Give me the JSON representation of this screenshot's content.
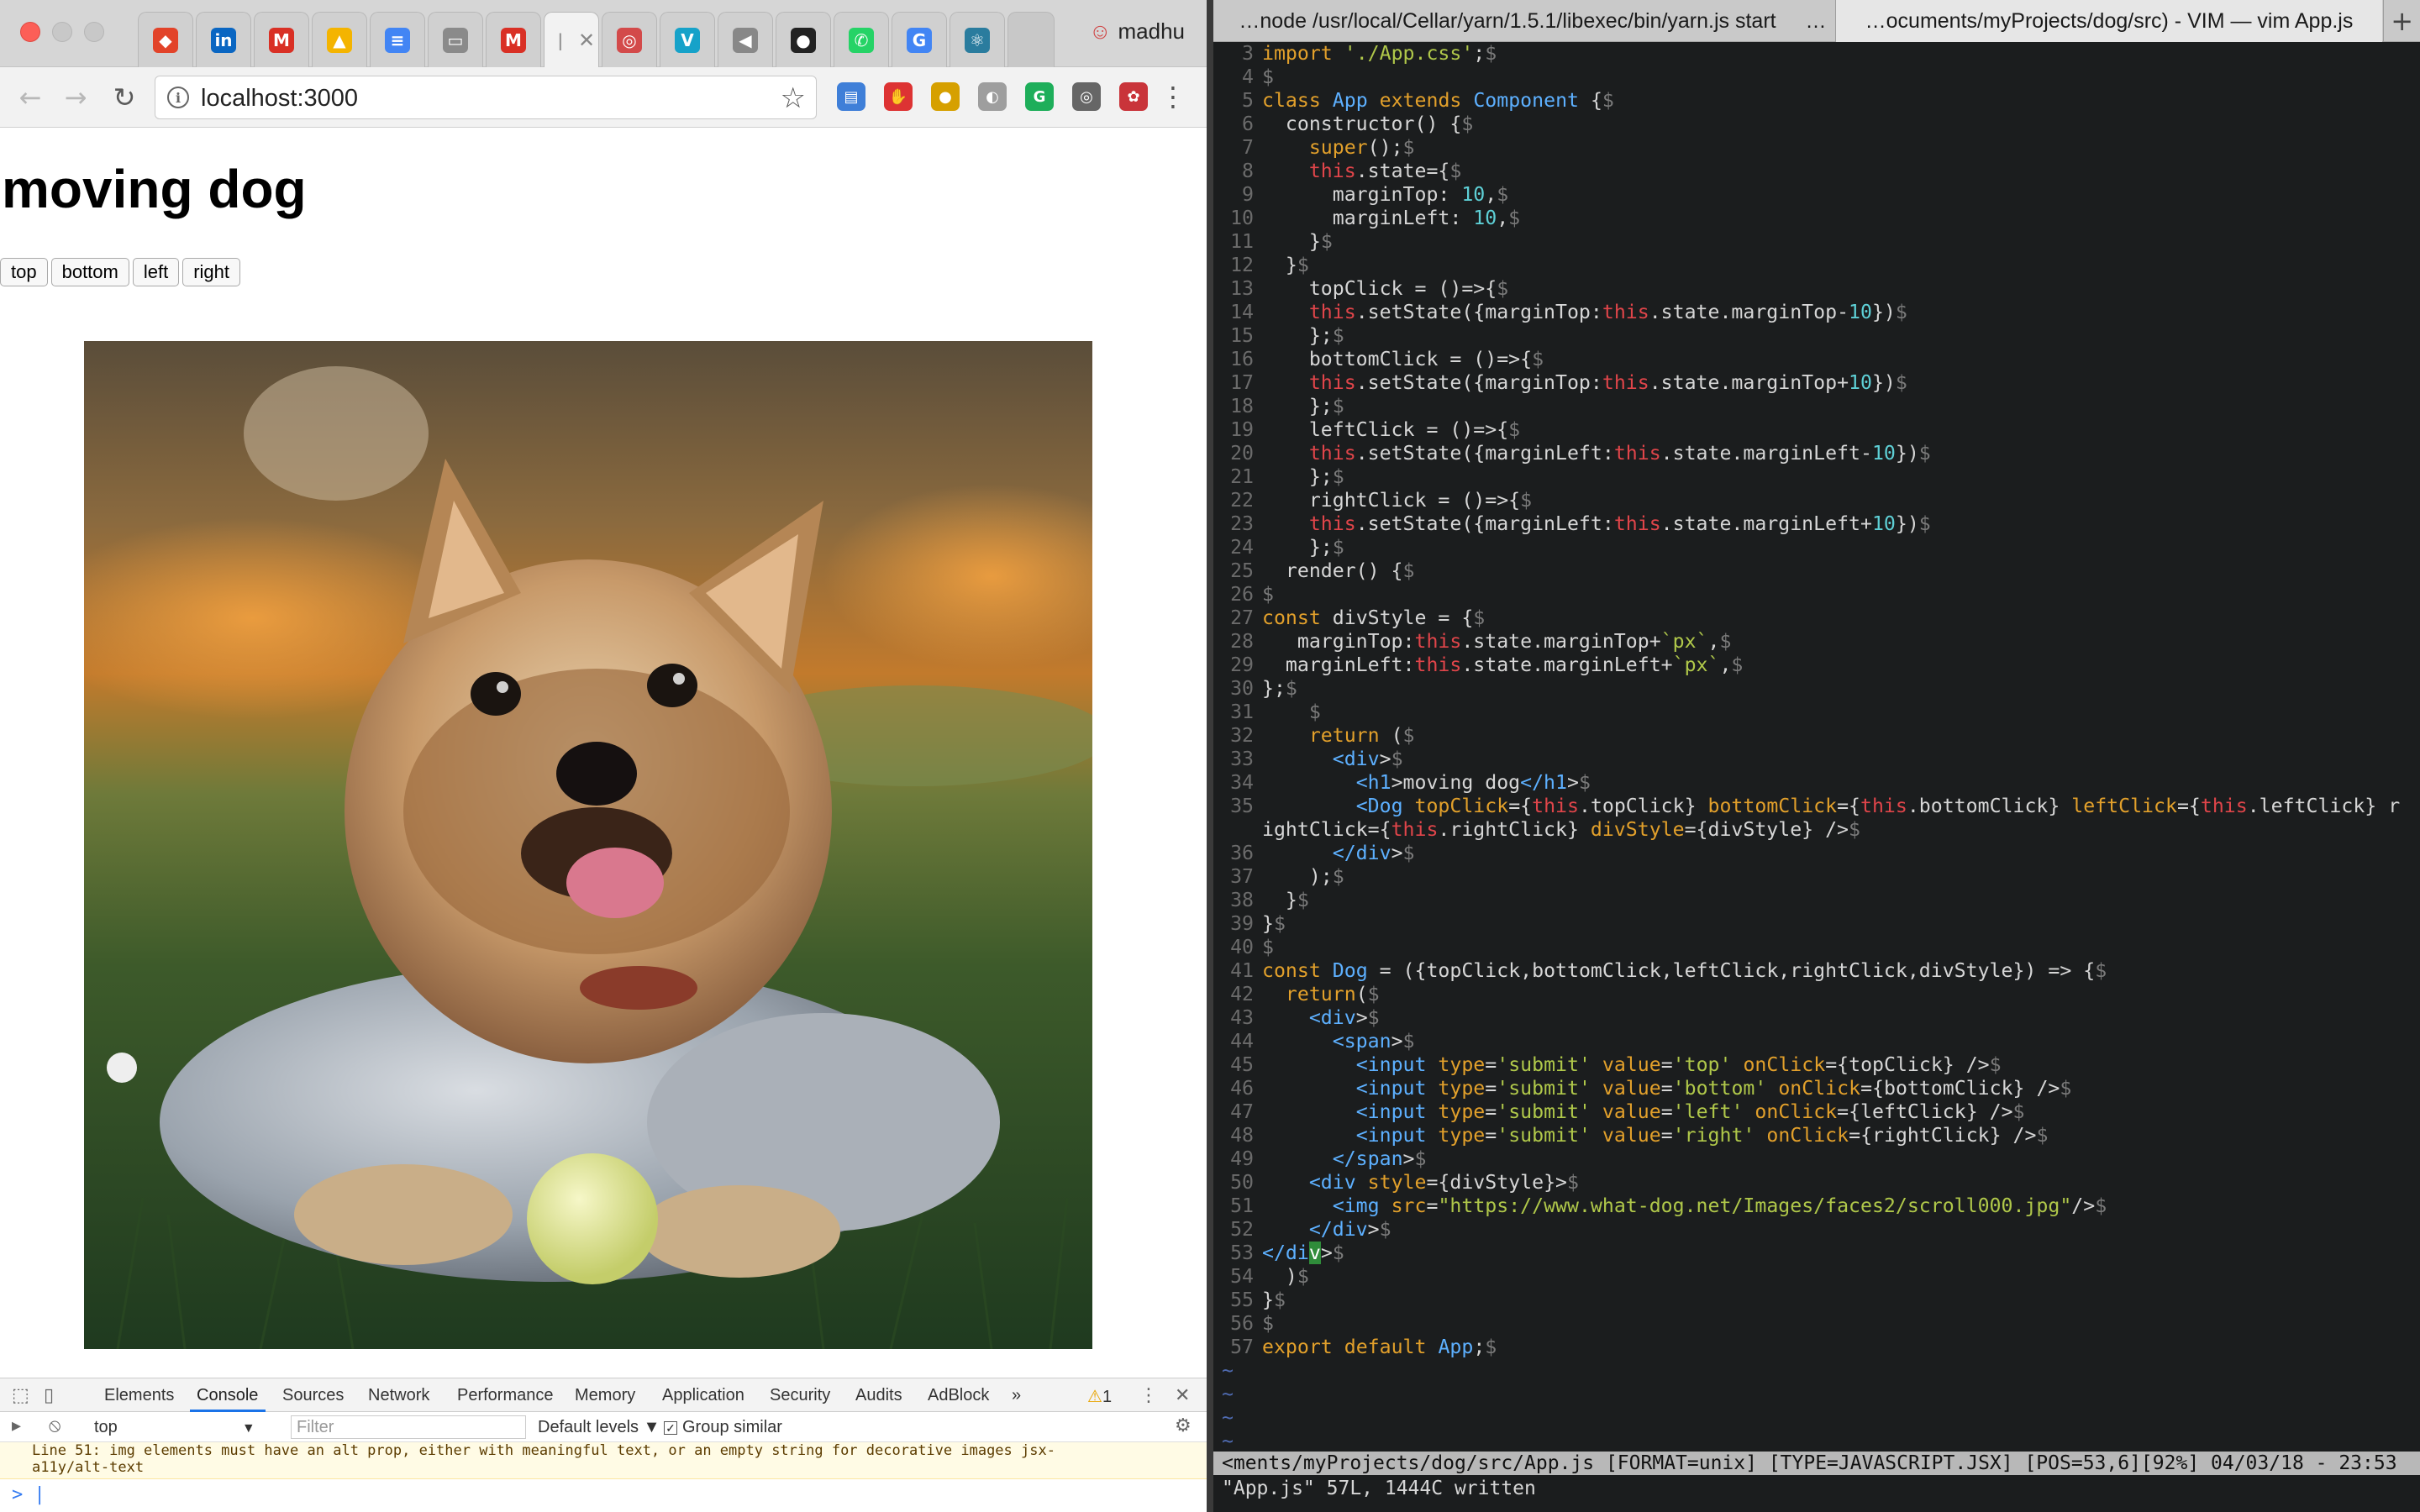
{
  "browser": {
    "profile_name": "madhu",
    "tabs": [
      {
        "icon": "gitlab-icon",
        "color": "#e24329"
      },
      {
        "icon": "linkedin-icon",
        "color": "#0a66c2"
      },
      {
        "icon": "gmail-icon",
        "color": "#d93025"
      },
      {
        "icon": "drive-icon",
        "color": "#f4b400"
      },
      {
        "icon": "docs-icon",
        "color": "#4285f4"
      },
      {
        "icon": "file-icon",
        "color": "#8a8a8a"
      },
      {
        "icon": "gmail-icon",
        "color": "#d93025"
      },
      {
        "icon": "active-tab-icon",
        "color": "#9a9a9a"
      },
      {
        "icon": "app-icon",
        "color": "#d34a4a"
      },
      {
        "icon": "vectr-icon",
        "color": "#16a2c9"
      },
      {
        "icon": "media-icon",
        "color": "#888888"
      },
      {
        "icon": "github-icon",
        "color": "#222222"
      },
      {
        "icon": "whatsapp-icon",
        "color": "#25d366"
      },
      {
        "icon": "google-icon",
        "color": "#4285f4"
      },
      {
        "icon": "react-icon",
        "color": "#2a7c9e"
      }
    ],
    "active_tab_close": "✕",
    "url": "localhost:3000",
    "extension_colors": [
      "#3f7fd8",
      "#d33",
      "#d6a000",
      "#9e9e9e",
      "#1eae5a",
      "#666",
      "#c9343a"
    ]
  },
  "page": {
    "title": "moving dog",
    "buttons": [
      "top",
      "bottom",
      "left",
      "right"
    ],
    "image_alt_subject": "yorkshire terrier puppy lying on grass with a tennis ball"
  },
  "devtools": {
    "tabs": [
      "Elements",
      "Console",
      "Sources",
      "Network",
      "Performance",
      "Memory",
      "Application",
      "Security",
      "Audits",
      "AdBlock"
    ],
    "active_tab": "Console",
    "more": "»",
    "warning_count": "1",
    "context": "top",
    "filter_placeholder": "Filter",
    "levels": "Default levels ▼",
    "group_similar": "Group similar",
    "warning_line1": "Line 51:  img elements must have an alt prop, either with meaningful text, or an empty string for decorative images  jsx-",
    "warning_line2": "a11y/alt-text",
    "prompt": "> |"
  },
  "terminal": {
    "tabs": [
      "…node /usr/local/Cellar/yarn/1.5.1/libexec/bin/yarn.js start",
      "…ocuments/myProjects/dog/src) - VIM — vim App.js"
    ],
    "tab_overflow": "…",
    "add_tab": "+",
    "statusline": "<ments/myProjects/dog/src/App.js [FORMAT=unix] [TYPE=JAVASCRIPT.JSX] [POS=53,6][92%] 04/03/18 - 23:53",
    "message": "\"App.js\" 57L, 1444C written",
    "tilde": "~",
    "code": [
      {
        "n": "3",
        "t": "import './App.css';$"
      },
      {
        "n": "4",
        "t": "$"
      },
      {
        "n": "5",
        "t": "class App extends Component {$"
      },
      {
        "n": "6",
        "t": "  constructor() {$"
      },
      {
        "n": "7",
        "t": "    super();$"
      },
      {
        "n": "8",
        "t": "    this.state={$"
      },
      {
        "n": "9",
        "t": "      marginTop: 10,$"
      },
      {
        "n": "10",
        "t": "      marginLeft: 10,$"
      },
      {
        "n": "11",
        "t": "    }$"
      },
      {
        "n": "12",
        "t": "  }$"
      },
      {
        "n": "13",
        "t": "    topClick = ()=>{$"
      },
      {
        "n": "14",
        "t": "    this.setState({marginTop:this.state.marginTop-10})$"
      },
      {
        "n": "15",
        "t": "    };$"
      },
      {
        "n": "16",
        "t": "    bottomClick = ()=>{$"
      },
      {
        "n": "17",
        "t": "    this.setState({marginTop:this.state.marginTop+10})$"
      },
      {
        "n": "18",
        "t": "    };$"
      },
      {
        "n": "19",
        "t": "    leftClick = ()=>{$"
      },
      {
        "n": "20",
        "t": "    this.setState({marginLeft:this.state.marginLeft-10})$"
      },
      {
        "n": "21",
        "t": "    };$"
      },
      {
        "n": "22",
        "t": "    rightClick = ()=>{$"
      },
      {
        "n": "23",
        "t": "    this.setState({marginLeft:this.state.marginLeft+10})$"
      },
      {
        "n": "24",
        "t": "    };$"
      },
      {
        "n": "25",
        "t": "  render() {$"
      },
      {
        "n": "26",
        "t": "$"
      },
      {
        "n": "27",
        "t": "const divStyle = {$"
      },
      {
        "n": "28",
        "t": "   marginTop:this.state.marginTop+`px`,$"
      },
      {
        "n": "29",
        "t": "  marginLeft:this.state.marginLeft+`px`,$"
      },
      {
        "n": "30",
        "t": "};$"
      },
      {
        "n": "31",
        "t": "    $"
      },
      {
        "n": "32",
        "t": "    return ($"
      },
      {
        "n": "33",
        "t": "      <div>$"
      },
      {
        "n": "34",
        "t": "        <h1>moving dog</h1>$"
      },
      {
        "n": "35",
        "t": "        <Dog topClick={this.topClick} bottomClick={this.bottomClick} leftClick={this.leftClick} r",
        "t2": "ightClick={this.rightClick} divStyle={divStyle} />$"
      },
      {
        "n": "36",
        "t": "      </div>$"
      },
      {
        "n": "37",
        "t": "    );$"
      },
      {
        "n": "38",
        "t": "  }$"
      },
      {
        "n": "39",
        "t": "}$"
      },
      {
        "n": "40",
        "t": "$"
      },
      {
        "n": "41",
        "t": "const Dog = ({topClick,bottomClick,leftClick,rightClick,divStyle}) => {$"
      },
      {
        "n": "42",
        "t": "  return($"
      },
      {
        "n": "43",
        "t": "    <div>$"
      },
      {
        "n": "44",
        "t": "      <span>$"
      },
      {
        "n": "45",
        "t": "        <input type='submit' value='top' onClick={topClick} />$"
      },
      {
        "n": "46",
        "t": "        <input type='submit' value='bottom' onClick={bottomClick} />$"
      },
      {
        "n": "47",
        "t": "        <input type='submit' value='left' onClick={leftClick} />$"
      },
      {
        "n": "48",
        "t": "        <input type='submit' value='right' onClick={rightClick} />$"
      },
      {
        "n": "49",
        "t": "      </span>$"
      },
      {
        "n": "50",
        "t": "    <div style={divStyle}>$"
      },
      {
        "n": "51",
        "t": "      <img src=\"https://www.what-dog.net/Images/faces2/scroll000.jpg\"/>$"
      },
      {
        "n": "52",
        "t": "    </div>$"
      },
      {
        "n": "53",
        "t": "</div>$"
      },
      {
        "n": "54",
        "t": "  )$"
      },
      {
        "n": "55",
        "t": "}$"
      },
      {
        "n": "56",
        "t": "$"
      },
      {
        "n": "57",
        "t": "export default App;$"
      }
    ]
  }
}
